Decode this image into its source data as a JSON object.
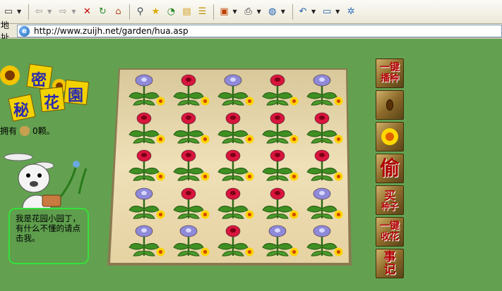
{
  "browser": {
    "address_label": "地址",
    "url": "http://www.zuijh.net/garden/hua.asp"
  },
  "logo": {
    "chars": [
      "秘",
      "密",
      "花",
      "園"
    ]
  },
  "status": {
    "prefix": "你拥有",
    "count_text": "0颗。"
  },
  "speech": "我是花园小园丁，有什么不懂的请点击我。",
  "garden": {
    "rows": [
      [
        "blue",
        "red",
        "blue",
        "red",
        "blue"
      ],
      [
        "red",
        "red",
        "red",
        "red",
        "red"
      ],
      [
        "red",
        "red",
        "red",
        "red",
        "red"
      ],
      [
        "blue",
        "red",
        "red",
        "red",
        "blue"
      ],
      [
        "blue",
        "blue",
        "red",
        "blue",
        "blue"
      ]
    ]
  },
  "side_buttons": {
    "plant_all": {
      "line1": "一键",
      "line2": "播种"
    },
    "seed": {
      "icon": "seed-icon"
    },
    "flower": {
      "icon": "sunflower-icon"
    },
    "steal": {
      "label": "偷"
    },
    "buy_seeds": {
      "line1": "买",
      "line2": "种子"
    },
    "harvest_all": {
      "line1": "一键",
      "line2": "收花"
    },
    "log": {
      "line1": "事",
      "line2": "记"
    }
  },
  "colors": {
    "page_bg": "#63a150",
    "field_bg": "#e8d8a8",
    "speech_border": "#36e03a",
    "button_text": "#b00000"
  }
}
